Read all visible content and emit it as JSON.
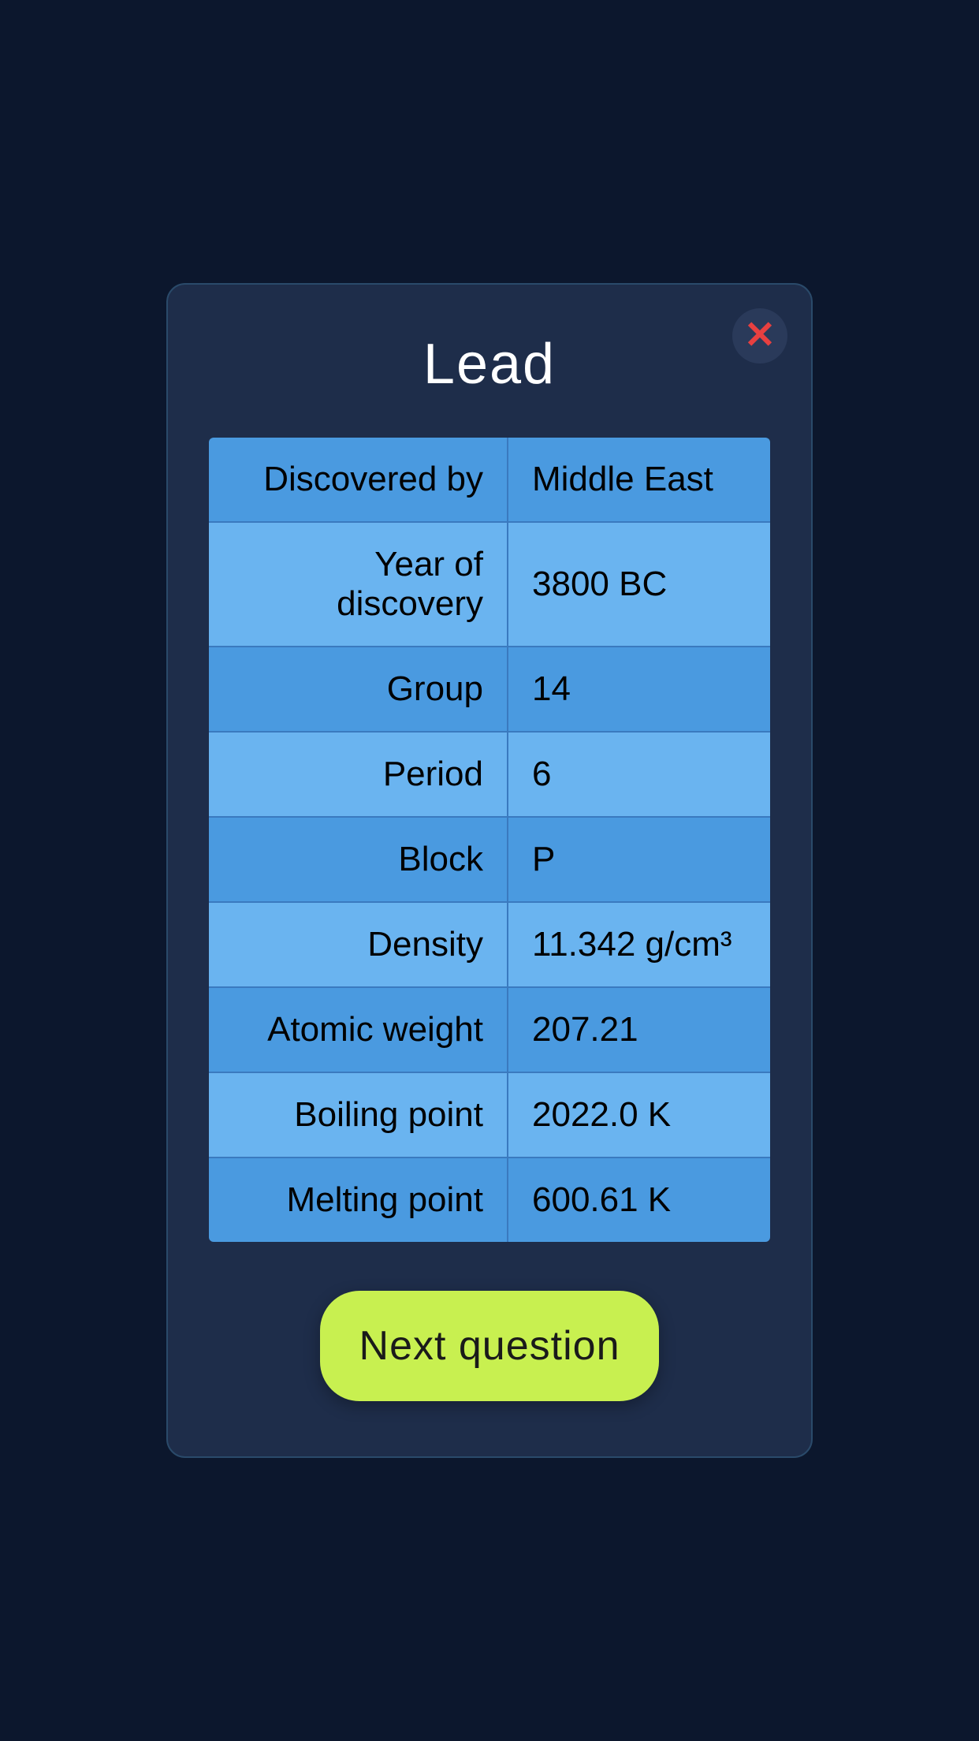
{
  "modal": {
    "title": "Lead",
    "close_label": "×"
  },
  "table": {
    "rows": [
      {
        "label": "Discovered by",
        "value": "Middle East"
      },
      {
        "label": "Year of discovery",
        "value": "3800 BC"
      },
      {
        "label": "Group",
        "value": "14"
      },
      {
        "label": "Period",
        "value": "6"
      },
      {
        "label": "Block",
        "value": "P"
      },
      {
        "label": "Density",
        "value": "11.342 g/cm³"
      },
      {
        "label": "Atomic weight",
        "value": "207.21"
      },
      {
        "label": "Boiling point",
        "value": "2022.0 K"
      },
      {
        "label": "Melting point",
        "value": "600.61 K"
      }
    ]
  },
  "button": {
    "next_label": "Next question"
  }
}
